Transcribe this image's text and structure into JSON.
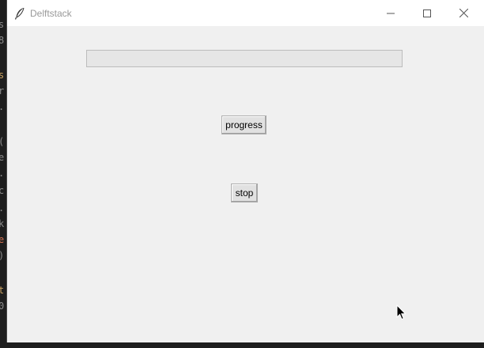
{
  "window": {
    "title": "Delftstack",
    "app_icon": "feather-icon",
    "controls": {
      "minimize": "minimize-icon",
      "maximize": "maximize-icon",
      "close": "close-icon"
    }
  },
  "progressbar": {
    "value_fraction": 0
  },
  "buttons": {
    "progress_label": "progress",
    "stop_label": "stop"
  },
  "background": {
    "fragments": [
      "s",
      "8",
      "s",
      "r",
      ".",
      "(",
      "e",
      ".",
      "c",
      ".",
      "k",
      "e",
      ")",
      "t",
      "0"
    ]
  },
  "colors": {
    "window_bg": "#f0f0f0",
    "titlebar_bg": "#ffffff",
    "progress_trough": "#e6e6e6",
    "progress_fill": "#06b025"
  }
}
